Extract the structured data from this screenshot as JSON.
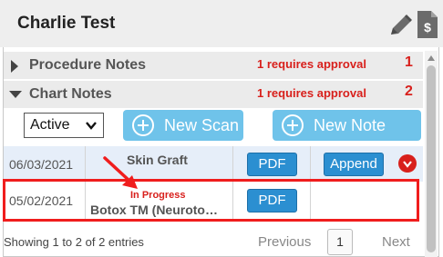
{
  "header": {
    "title": "Charlie Test",
    "icons": [
      "pencil-icon",
      "billing-document-icon"
    ]
  },
  "sections": [
    {
      "title": "Procedure Notes",
      "approval": "1 requires approval",
      "number": "1",
      "expanded": false
    },
    {
      "title": "Chart Notes",
      "approval": "1 requires approval",
      "number": "2",
      "expanded": true
    }
  ],
  "toolbar": {
    "status_value": "Active",
    "new_scan_label": "New Scan",
    "new_note_label": "New Note"
  },
  "rows": [
    {
      "date": "06/03/2021",
      "type": "Skin Graft",
      "status": "",
      "pdf_label": "PDF",
      "append_label": "Append"
    },
    {
      "date": "05/02/2021",
      "type": "Botox TM (Neuroto…",
      "status": "In Progress",
      "pdf_label": "PDF"
    }
  ],
  "footer": {
    "info": "Showing 1 to 2 of 2 entries",
    "previous": "Previous",
    "page": "1",
    "next": "Next"
  },
  "colors": {
    "accent_blue": "#2b8fd1",
    "light_blue_button": "#6fc3ea",
    "alert_red": "#d8201c",
    "highlight_red": "#f01d1d"
  }
}
